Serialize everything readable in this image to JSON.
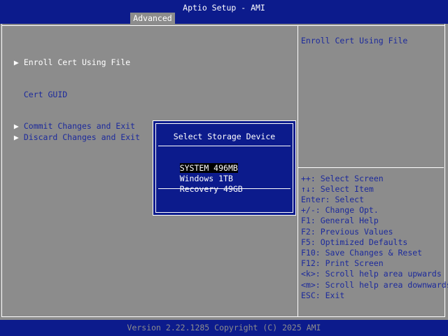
{
  "header": {
    "app_title": "Aptio Setup - AMI",
    "active_tab": "Advanced"
  },
  "menu": {
    "items": [
      {
        "label": "Enroll Cert Using File",
        "has_submenu": true,
        "selected": true
      },
      {
        "label": "Cert GUID",
        "has_submenu": false,
        "selected": false
      },
      {
        "label": "Commit Changes and Exit",
        "has_submenu": true,
        "selected": false
      },
      {
        "label": "Discard Changes and Exit",
        "has_submenu": true,
        "selected": false
      }
    ]
  },
  "help": {
    "title": "Enroll Cert Using File"
  },
  "hints": [
    "++: Select Screen",
    "↑↓: Select Item",
    "Enter: Select",
    "+/-: Change Opt.",
    "F1: General Help",
    "F2: Previous Values",
    "F5: Optimized Defaults",
    "F10: Save Changes & Reset",
    "F12: Print Screen",
    "<k>: Scroll help area upwards",
    "<m>: Scroll help area downwards",
    "ESC: Exit"
  ],
  "popup": {
    "title": "Select Storage Device",
    "options": [
      {
        "label": "SYSTEM 496MB",
        "selected": true
      },
      {
        "label": "Windows 1TB",
        "selected": false
      },
      {
        "label": "Recovery 49GB",
        "selected": false
      }
    ]
  },
  "footer": {
    "version": "Version 2.22.1285 Copyright (C) 2025 AMI"
  },
  "colors": {
    "bar_blue": "#0c1b8c",
    "panel_gray": "#8c8c8c",
    "item_blue": "#1c2a9c",
    "highlight": "#ffffff"
  },
  "icons": {
    "submenu_arrow": "triangle-right-icon"
  }
}
